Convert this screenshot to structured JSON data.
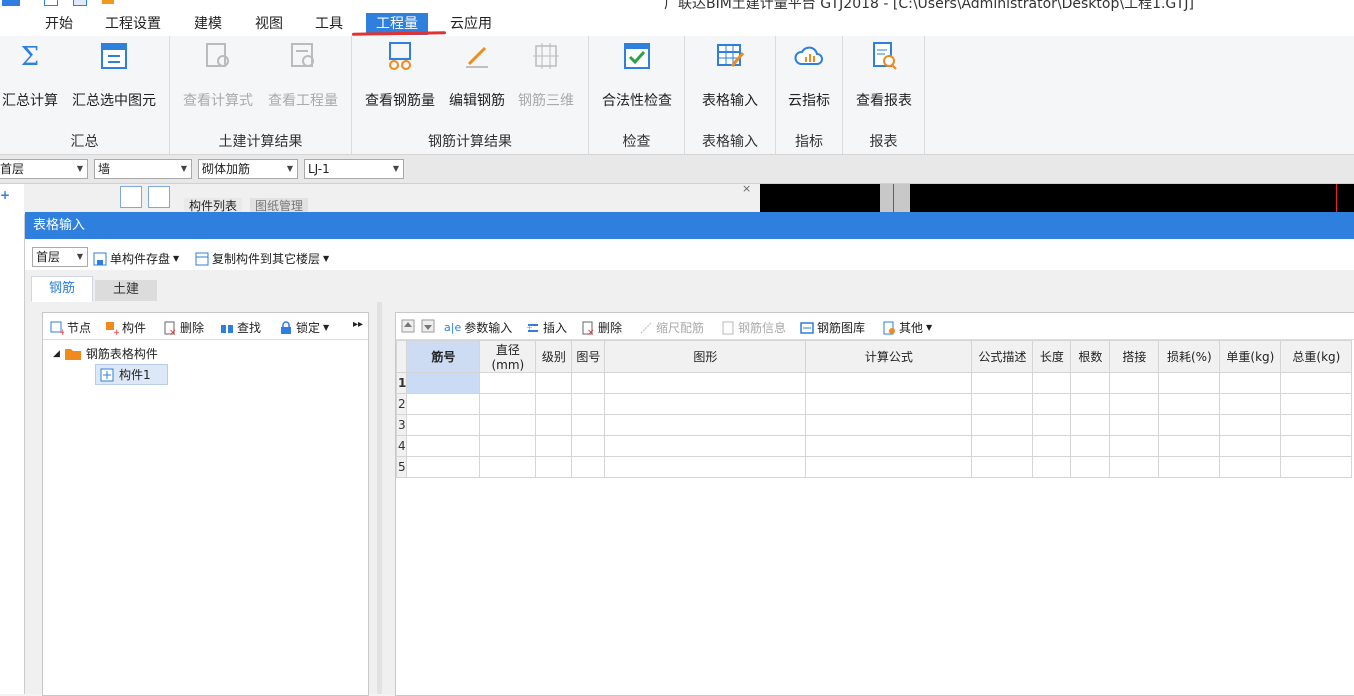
{
  "window": {
    "title": "广联达BIM土建计量平台 GTJ2018 - [C:\\Users\\Administrator\\Desktop\\工程1.GTJ]"
  },
  "menu": [
    "开始",
    "工程设置",
    "建模",
    "视图",
    "工具",
    "工程量",
    "云应用"
  ],
  "ribbon": {
    "groups": [
      {
        "label": "汇总",
        "buttons": [
          "汇总计算",
          "汇总选中图元"
        ]
      },
      {
        "label": "土建计算结果",
        "buttons": [
          "查看计算式",
          "查看工程量"
        ]
      },
      {
        "label": "钢筋计算结果",
        "buttons": [
          "查看钢筋量",
          "编辑钢筋",
          "钢筋三维"
        ]
      },
      {
        "label": "检查",
        "buttons": [
          "合法性检查"
        ]
      },
      {
        "label": "表格输入",
        "buttons": [
          "表格输入"
        ]
      },
      {
        "label": "指标",
        "buttons": [
          "云指标"
        ]
      },
      {
        "label": "报表",
        "buttons": [
          "查看报表"
        ]
      }
    ]
  },
  "selectors": {
    "floor": "首层",
    "type": "墙",
    "subtype": "砌体加筋",
    "element": "LJ-1"
  },
  "background_tabs": [
    "构件列表",
    "图纸管理"
  ],
  "dialog": {
    "title": "表格输入",
    "toolbar": {
      "floor": "首层",
      "save": "单构件存盘",
      "copy": "复制构件到其它楼层"
    },
    "tabs": [
      "钢筋",
      "土建"
    ],
    "left_toolbar": [
      "节点",
      "构件",
      "删除",
      "查找",
      "锁定"
    ],
    "tree": {
      "root": "钢筋表格构件",
      "child": "构件1"
    },
    "right_toolbar": [
      "参数输入",
      "插入",
      "删除",
      "缩尺配筋",
      "钢筋信息",
      "钢筋图库",
      "其他"
    ],
    "grid": {
      "columns": [
        "筋号",
        "直径(mm)",
        "级别",
        "图号",
        "图形",
        "计算公式",
        "公式描述",
        "长度",
        "根数",
        "搭接",
        "损耗(%)",
        "单重(kg)",
        "总重(kg)"
      ],
      "rows": [
        "1",
        "2",
        "3",
        "4",
        "5"
      ]
    }
  },
  "colors": {
    "accent": "#2f7fde",
    "annotation_red": "#e53030"
  }
}
